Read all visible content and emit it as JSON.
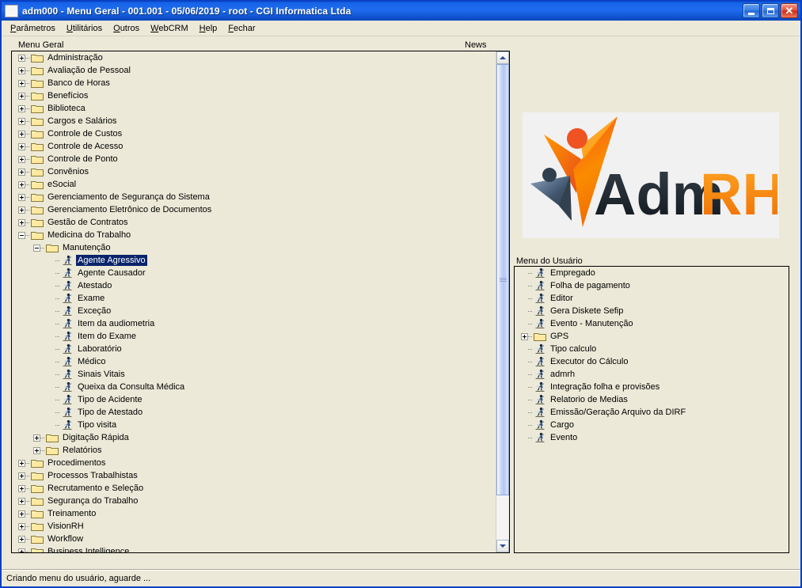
{
  "window": {
    "title": "adm000  - Menu Geral -  001.001 - 05/06/2019 - root - CGI Informatica Ltda",
    "icon": "app-icon",
    "buttons": {
      "minimize": "_",
      "maximize": "□",
      "close": "✕"
    },
    "colors": {
      "titlebar_blue": "#1763e8",
      "window_face": "#ece9d8",
      "selection_blue": "#0a246a",
      "folder_yellow": "#ffe9a0",
      "accent_orange": "#f07d20"
    }
  },
  "menubar": {
    "items": [
      {
        "label": "Parâmetros",
        "accel": "P"
      },
      {
        "label": "Utilitários",
        "accel": "U"
      },
      {
        "label": "Outros",
        "accel": "O"
      },
      {
        "label": "WebCRM",
        "accel": "W"
      },
      {
        "label": "Help",
        "accel": "H"
      },
      {
        "label": "Fechar",
        "accel": "F"
      }
    ]
  },
  "left_panel": {
    "label": "Menu Geral",
    "tree": [
      {
        "label": "Administração",
        "level": 0,
        "type": "folder",
        "state": "collapsed"
      },
      {
        "label": "Avaliação de Pessoal",
        "level": 0,
        "type": "folder",
        "state": "collapsed"
      },
      {
        "label": "Banco de Horas",
        "level": 0,
        "type": "folder",
        "state": "collapsed"
      },
      {
        "label": "Benefícios",
        "level": 0,
        "type": "folder",
        "state": "collapsed"
      },
      {
        "label": "Biblioteca",
        "level": 0,
        "type": "folder",
        "state": "collapsed"
      },
      {
        "label": "Cargos e Salários",
        "level": 0,
        "type": "folder",
        "state": "collapsed"
      },
      {
        "label": "Controle de Custos",
        "level": 0,
        "type": "folder",
        "state": "collapsed"
      },
      {
        "label": "Controle de Acesso",
        "level": 0,
        "type": "folder",
        "state": "collapsed"
      },
      {
        "label": "Controle de Ponto",
        "level": 0,
        "type": "folder",
        "state": "collapsed"
      },
      {
        "label": "Convênios",
        "level": 0,
        "type": "folder",
        "state": "collapsed"
      },
      {
        "label": "eSocial",
        "level": 0,
        "type": "folder",
        "state": "collapsed"
      },
      {
        "label": "Gerenciamento de Segurança do Sistema",
        "level": 0,
        "type": "folder",
        "state": "collapsed"
      },
      {
        "label": "Gerenciamento Eletrônico de Documentos",
        "level": 0,
        "type": "folder",
        "state": "collapsed"
      },
      {
        "label": "Gestão de Contratos",
        "level": 0,
        "type": "folder",
        "state": "collapsed"
      },
      {
        "label": "Medicina do Trabalho",
        "level": 0,
        "type": "folder",
        "state": "expanded"
      },
      {
        "label": "Manutenção",
        "level": 1,
        "type": "folder",
        "state": "expanded"
      },
      {
        "label": "Agente Agressivo",
        "level": 2,
        "type": "leaf",
        "state": "none",
        "selected": true
      },
      {
        "label": "Agente Causador",
        "level": 2,
        "type": "leaf",
        "state": "none"
      },
      {
        "label": "Atestado",
        "level": 2,
        "type": "leaf",
        "state": "none"
      },
      {
        "label": "Exame",
        "level": 2,
        "type": "leaf",
        "state": "none"
      },
      {
        "label": "Exceção",
        "level": 2,
        "type": "leaf",
        "state": "none"
      },
      {
        "label": "Item da audiometria",
        "level": 2,
        "type": "leaf",
        "state": "none"
      },
      {
        "label": "Item do Exame",
        "level": 2,
        "type": "leaf",
        "state": "none"
      },
      {
        "label": "Laboratório",
        "level": 2,
        "type": "leaf",
        "state": "none"
      },
      {
        "label": "Médico",
        "level": 2,
        "type": "leaf",
        "state": "none"
      },
      {
        "label": "Sinais Vitais",
        "level": 2,
        "type": "leaf",
        "state": "none"
      },
      {
        "label": "Queixa da Consulta Médica",
        "level": 2,
        "type": "leaf",
        "state": "none"
      },
      {
        "label": "Tipo de Acidente",
        "level": 2,
        "type": "leaf",
        "state": "none"
      },
      {
        "label": "Tipo de Atestado",
        "level": 2,
        "type": "leaf",
        "state": "none"
      },
      {
        "label": "Tipo visita",
        "level": 2,
        "type": "leaf",
        "state": "none"
      },
      {
        "label": "Digitação Rápida",
        "level": 1,
        "type": "folder",
        "state": "collapsed"
      },
      {
        "label": "Relatórios",
        "level": 1,
        "type": "folder",
        "state": "collapsed"
      },
      {
        "label": "Procedimentos",
        "level": 0,
        "type": "folder",
        "state": "collapsed"
      },
      {
        "label": "Processos Trabalhistas",
        "level": 0,
        "type": "folder",
        "state": "collapsed"
      },
      {
        "label": "Recrutamento e Seleção",
        "level": 0,
        "type": "folder",
        "state": "collapsed"
      },
      {
        "label": "Segurança do Trabalho",
        "level": 0,
        "type": "folder",
        "state": "collapsed"
      },
      {
        "label": "Treinamento",
        "level": 0,
        "type": "folder",
        "state": "collapsed"
      },
      {
        "label": "VisionRH",
        "level": 0,
        "type": "folder",
        "state": "collapsed"
      },
      {
        "label": "Workflow",
        "level": 0,
        "type": "folder",
        "state": "collapsed"
      },
      {
        "label": "Business Intelligence",
        "level": 0,
        "type": "folder",
        "state": "collapsed"
      }
    ],
    "scrollbar": {
      "up_arrow": "▲",
      "down_arrow": "▼"
    }
  },
  "right_panel": {
    "news_label": "News",
    "logo": {
      "alt": "AdmRH",
      "text_dark": "Adm",
      "text_orange": "RH"
    },
    "user_menu_label": "Menu do Usuário",
    "user_tree": [
      {
        "label": "Empregado",
        "level": 0,
        "type": "leaf",
        "state": "none"
      },
      {
        "label": "Folha de pagamento",
        "level": 0,
        "type": "leaf",
        "state": "none"
      },
      {
        "label": "Editor",
        "level": 0,
        "type": "leaf",
        "state": "none"
      },
      {
        "label": "Gera Diskete Sefip",
        "level": 0,
        "type": "leaf",
        "state": "none"
      },
      {
        "label": "Evento - Manutenção",
        "level": 0,
        "type": "leaf",
        "state": "none"
      },
      {
        "label": "GPS",
        "level": 0,
        "type": "folder",
        "state": "collapsed"
      },
      {
        "label": "Tipo calculo",
        "level": 0,
        "type": "leaf",
        "state": "none"
      },
      {
        "label": "Executor do Cálculo",
        "level": 0,
        "type": "leaf",
        "state": "none"
      },
      {
        "label": "admrh",
        "level": 0,
        "type": "leaf",
        "state": "none"
      },
      {
        "label": "Integração folha e provisões",
        "level": 0,
        "type": "leaf",
        "state": "none"
      },
      {
        "label": "Relatorio de Medias",
        "level": 0,
        "type": "leaf",
        "state": "none"
      },
      {
        "label": "Emissão/Geração Arquivo da DIRF",
        "level": 0,
        "type": "leaf",
        "state": "none"
      },
      {
        "label": "Cargo",
        "level": 0,
        "type": "leaf",
        "state": "none"
      },
      {
        "label": "Evento",
        "level": 0,
        "type": "leaf",
        "state": "none"
      }
    ]
  },
  "statusbar": {
    "message": "Criando menu do usuário, aguarde ..."
  }
}
